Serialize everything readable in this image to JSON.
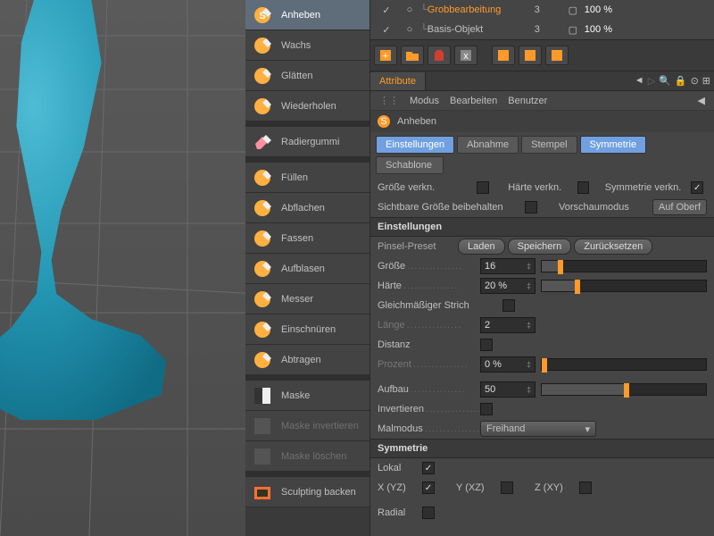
{
  "tools": [
    {
      "label": "Anheben",
      "icon": "sphere-s",
      "active": true
    },
    {
      "label": "Wachs",
      "icon": "wax"
    },
    {
      "label": "Glätten",
      "icon": "smooth"
    },
    {
      "label": "Wiederholen",
      "icon": "repeat"
    },
    {
      "spacer": true
    },
    {
      "label": "Radiergummi",
      "icon": "eraser"
    },
    {
      "spacer": true
    },
    {
      "label": "Füllen",
      "icon": "fill"
    },
    {
      "label": "Abflachen",
      "icon": "flatten"
    },
    {
      "label": "Fassen",
      "icon": "grab"
    },
    {
      "label": "Aufblasen",
      "icon": "inflate"
    },
    {
      "label": "Messer",
      "icon": "knife"
    },
    {
      "label": "Einschnüren",
      "icon": "pinch"
    },
    {
      "label": "Abtragen",
      "icon": "scrape"
    },
    {
      "spacer": true
    },
    {
      "label": "Maske",
      "icon": "mask"
    },
    {
      "label": "Maske invertieren",
      "icon": "mask-inv",
      "disabled": true
    },
    {
      "label": "Maske löschen",
      "icon": "mask-del",
      "disabled": true
    },
    {
      "spacer": true
    },
    {
      "label": "Sculpting backen",
      "icon": "bake"
    }
  ],
  "layers": [
    {
      "vis": true,
      "name": "Grobbearbeitung",
      "hl": true,
      "val": "3",
      "pct": "100 %"
    },
    {
      "vis": true,
      "name": "Basis-Objekt",
      "hl": false,
      "val": "3",
      "pct": "100 %"
    }
  ],
  "attr_tab": "Attribute",
  "menus": {
    "modus": "Modus",
    "bearbeiten": "Bearbeiten",
    "benutzer": "Benutzer"
  },
  "brush": {
    "title": "Anheben"
  },
  "subtabs": {
    "settings": "Einstellungen",
    "falloff": "Abnahme",
    "stamp": "Stempel",
    "symmetry": "Symmetrie",
    "stencil": "Schablone"
  },
  "props": {
    "size_link": "Größe verkn.",
    "hard_link": "Härte verkn.",
    "sym_link": "Symmetrie verkn.",
    "keep_vis_size": "Sichtbare Größe beibehalten",
    "preview_mode": "Vorschaumodus",
    "preview_val": "Auf Oberf",
    "section_settings": "Einstellungen",
    "preset": "Pinsel-Preset",
    "load": "Laden",
    "save": "Speichern",
    "reset": "Zurücksetzen",
    "size": "Größe",
    "size_val": "16",
    "hard": "Härte",
    "hard_val": "20 %",
    "even": "Gleichmäßiger Strich",
    "len": "Länge",
    "len_val": "2",
    "dist": "Distanz",
    "pct": "Prozent",
    "pct_val": "0 %",
    "build": "Aufbau",
    "build_val": "50",
    "invert": "Invertieren",
    "paint": "Malmodus",
    "paint_val": "Freihand",
    "section_sym": "Symmetrie",
    "local": "Lokal",
    "xyz": "X (YZ)",
    "yxz": "Y (XZ)",
    "zxy": "Z (XY)",
    "radial": "Radial"
  }
}
